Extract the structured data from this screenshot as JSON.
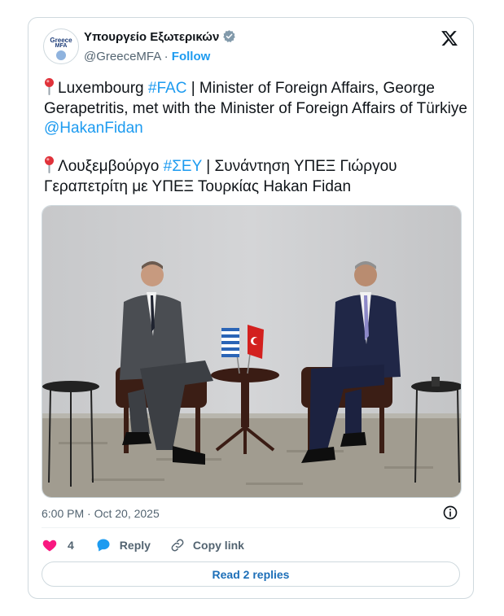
{
  "account": {
    "name": "Υπουργείο Εξωτερικών",
    "handle": "@GreeceMFA",
    "separator": "·",
    "follow_label": "Follow",
    "avatar_line1": "Greece",
    "avatar_line2": "MFA"
  },
  "tweet": {
    "en": {
      "place": "Luxembourg",
      "tag": "#FAC",
      "body": " | Minister of Foreign Affairs, George Gerapetritis, met with the Minister of Foreign Affairs of Türkiye ",
      "mention": "@HakanFidan"
    },
    "el": {
      "place": "Λουξεμβούργο",
      "tag": "#ΣΕΥ",
      "body": " | Συνάντηση ΥΠΕΞ Γιώργου Γεραπετρίτη με ΥΠΕΞ Τουρκίας Hakan Fidan"
    }
  },
  "timestamp": "6:00 PM · Oct 20, 2025",
  "actions": {
    "like_count": "4",
    "reply_label": "Reply",
    "copy_label": "Copy link"
  },
  "read_replies_label": "Read 2 replies",
  "colors": {
    "accent": "#1d9bf0",
    "like": "#f91880",
    "muted": "#536471",
    "border": "#cfd9de"
  },
  "icons": [
    "verified-badge-icon",
    "x-logo-icon",
    "pin-icon",
    "info-icon",
    "heart-icon",
    "reply-bubble-icon",
    "link-icon"
  ]
}
